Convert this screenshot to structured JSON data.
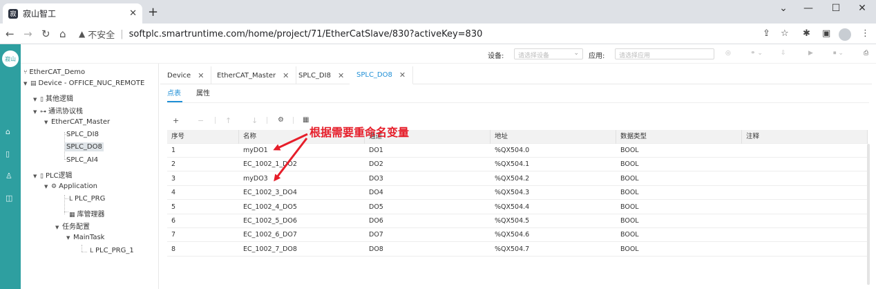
{
  "browser": {
    "tab_title": "寂山智工",
    "favicon_glyph": "寂",
    "insecure_label": "不安全",
    "separator": "|",
    "url": "softplc.smartruntime.com/home/project/71/EtherCatSlave/830?activeKey=830"
  },
  "app": {
    "logo_text": "寂山",
    "device_label": "设备:",
    "device_placeholder": "请选择设备",
    "app_label": "应用:",
    "app_placeholder": "请选择应用"
  },
  "tree": {
    "root": "EtherCAT_Demo",
    "device": "Device - OFFICE_NUC_REMOTE",
    "other_logic": "其他逻辑",
    "comm_protocol": "通讯协议栈",
    "ethercat_master": "EtherCAT_Master",
    "splc_di8": "SPLC_DI8",
    "splc_do8": "SPLC_DO8",
    "splc_ai4": "SPLC_AI4",
    "plc_logic": "PLC逻辑",
    "application": "Application",
    "plc_prg": "PLC_PRG",
    "lib_manager": "库管理器",
    "task_config": "任务配置",
    "main_task": "MainTask",
    "plc_prg_1": "PLC_PRG_1"
  },
  "editor_tabs": [
    {
      "label": "Device"
    },
    {
      "label": "EtherCAT_Master"
    },
    {
      "label": "SPLC_DI8"
    },
    {
      "label": "SPLC_DO8"
    }
  ],
  "sub_tabs": {
    "points": "点表",
    "props": "属性"
  },
  "annotation": "根据需要重命名变量",
  "table": {
    "headers": [
      "序号",
      "名称",
      "通道",
      "地址",
      "数据类型",
      "注释"
    ],
    "rows": [
      [
        "1",
        "myDO1",
        "DO1",
        "%QX504.0",
        "BOOL",
        ""
      ],
      [
        "2",
        "EC_1002_1_DO2",
        "DO2",
        "%QX504.1",
        "BOOL",
        ""
      ],
      [
        "3",
        "myDO3",
        "DO3",
        "%QX504.2",
        "BOOL",
        ""
      ],
      [
        "4",
        "EC_1002_3_DO4",
        "DO4",
        "%QX504.3",
        "BOOL",
        ""
      ],
      [
        "5",
        "EC_1002_4_DO5",
        "DO5",
        "%QX504.4",
        "BOOL",
        ""
      ],
      [
        "6",
        "EC_1002_5_DO6",
        "DO6",
        "%QX504.5",
        "BOOL",
        ""
      ],
      [
        "7",
        "EC_1002_6_DO7",
        "DO7",
        "%QX504.6",
        "BOOL",
        ""
      ],
      [
        "8",
        "EC_1002_7_DO8",
        "DO8",
        "%QX504.7",
        "BOOL",
        ""
      ]
    ]
  },
  "colors": {
    "accent": "#1f8fd6",
    "rail": "#2e9fa0",
    "annotation": "#e61e2a"
  },
  "icons": [
    "close-icon",
    "plus-icon",
    "minus-icon",
    "arrow-up-icon",
    "arrow-down-icon",
    "gear-icon",
    "grid-icon",
    "home-icon",
    "folder-icon",
    "lock-icon",
    "search-icon",
    "bookmark-icon"
  ]
}
